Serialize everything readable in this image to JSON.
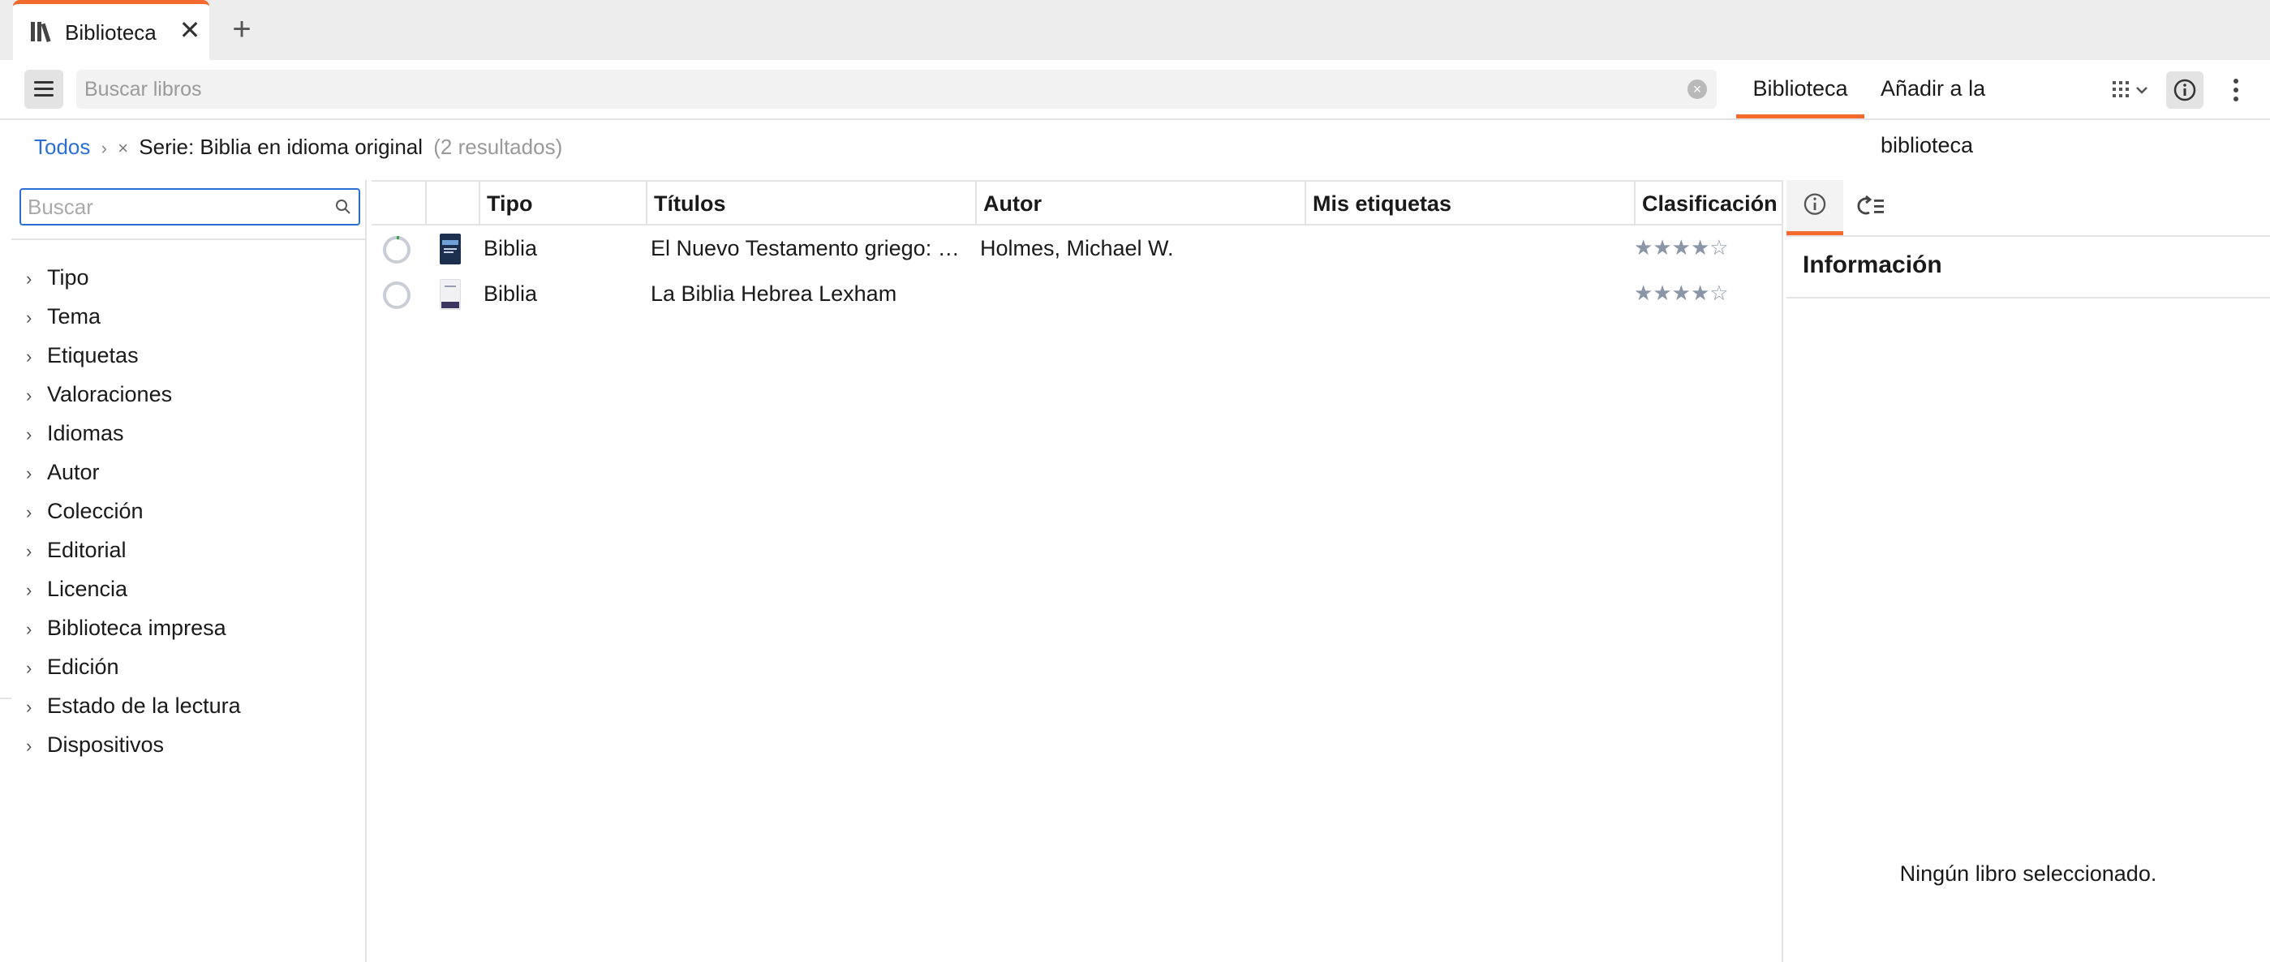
{
  "tab": {
    "icon": "library-icon",
    "label": "Biblioteca",
    "close_symbol": "✕",
    "add_symbol": "+"
  },
  "toolbar": {
    "search_placeholder": "Buscar libros",
    "clear_symbol": "×",
    "tab_library": "Biblioteca",
    "tab_add": "Añadir a la biblioteca"
  },
  "breadcrumb": {
    "root": "Todos",
    "separator": "›",
    "remove_symbol": "×",
    "filter": "Serie: Biblia en idioma original",
    "count": "(2 resultados)"
  },
  "filters": {
    "search_placeholder": "Buscar",
    "items": [
      "Tipo",
      "Tema",
      "Etiquetas",
      "Valoraciones",
      "Idiomas",
      "Autor",
      "Colección",
      "Editorial",
      "Licencia",
      "Biblioteca impresa",
      "Edición",
      "Estado de la lectura",
      "Dispositivos"
    ]
  },
  "table": {
    "columns": [
      "Tipo",
      "Títulos",
      "Autor",
      "Mis etiquetas",
      "Clasificación"
    ],
    "rows": [
      {
        "tipo": "Biblia",
        "titulo": "El Nuevo Testamento griego: Edición SBL",
        "autor": "Holmes, Michael W.",
        "etiquetas": "",
        "rating": 4
      },
      {
        "tipo": "Biblia",
        "titulo": "La Biblia Hebrea Lexham",
        "autor": "",
        "etiquetas": "",
        "rating": 4
      }
    ]
  },
  "info_panel": {
    "title": "Información",
    "empty_message": "Ningún libro seleccionado."
  },
  "colors": {
    "accent": "#f26a2e",
    "link": "#2b6fd6",
    "star": "#8a96a8"
  }
}
